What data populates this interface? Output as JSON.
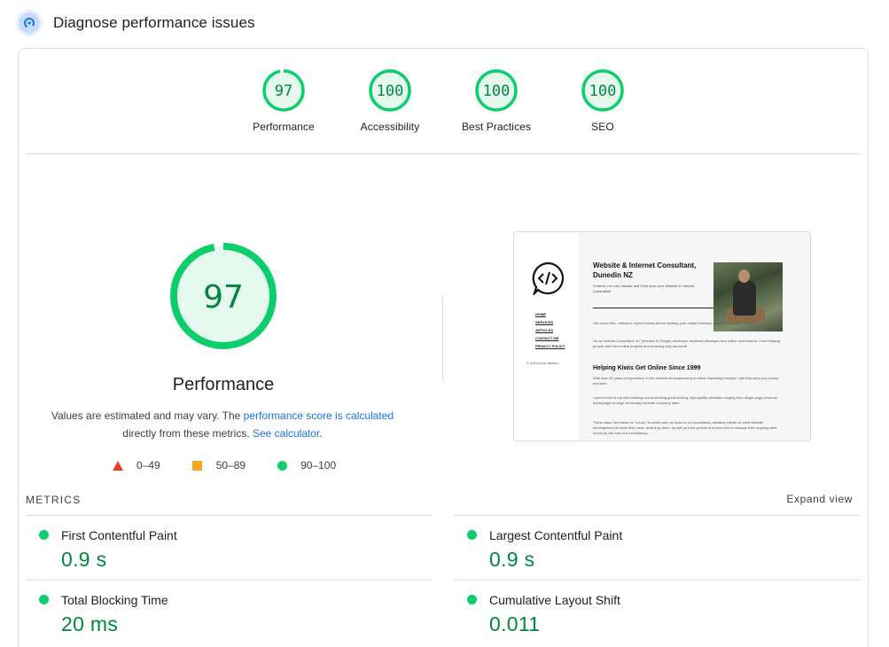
{
  "header": {
    "title": "Diagnose performance issues",
    "icon": "pagespeed-gauge-icon"
  },
  "categories": [
    {
      "score": "97",
      "label": "Performance",
      "fraction": 0.97
    },
    {
      "score": "100",
      "label": "Accessibility",
      "fraction": 1.0
    },
    {
      "score": "100",
      "label": "Best Practices",
      "fraction": 1.0
    },
    {
      "score": "100",
      "label": "SEO",
      "fraction": 1.0
    }
  ],
  "main_gauge": {
    "score": "97",
    "title": "Performance",
    "fraction": 0.97
  },
  "disclaimer": {
    "text1": "Values are estimated and may vary. The ",
    "link1": "performance score is calculated",
    "text2": " directly from these metrics. ",
    "link2": "See calculator",
    "text3": "."
  },
  "legend": {
    "fail": "0–49",
    "average": "50–89",
    "pass": "90–100"
  },
  "screenshot": {
    "heading": "Website & Internet Consultant, Dunedin NZ",
    "intro": "Hi there, I'm Lars Jansen and I'll be your next Website & Internet Consultant!",
    "nav": [
      "HOME",
      "SERVICES",
      "ARTICLES",
      "CONTACT ME",
      "PRIVACY POLICY"
    ],
    "copyright": "© 2024 Lars Jansen",
    "p1": "Get some free, unbiased, expert advice before starting your online business, project or website re-birth.",
    "p2": "I'm an Internet Consultant, IoT (Internet of Things) developer, backend developer and coffee connoisseur. I love helping people with their online projects and ensuring they succeed!",
    "subheading": "Helping Kiwis Get Online Since 1999",
    "p3": "With over 25 years of experience in the website development and online marketing industry I will help save you money and time.",
    "p4": "I spent most of my time building and promoting great looking, high quality websites ranging from single page personal homepages to large technically intricate company sites.",
    "p5": "These days I am based in \"sunny\" Dunedin and my focus is on consultancy, advising clients on what website development services they need, what they don't, as well as their options and how best to manage their ongoing sites, hourly by the cost of a consultancy..."
  },
  "metrics": {
    "title": "METRICS",
    "expand_label": "Expand view",
    "items": [
      {
        "name": "First Contentful Paint",
        "value": "0.9 s"
      },
      {
        "name": "Largest Contentful Paint",
        "value": "0.9 s"
      },
      {
        "name": "Total Blocking Time",
        "value": "20 ms"
      },
      {
        "name": "Cumulative Layout Shift",
        "value": "0.011"
      }
    ]
  },
  "colors": {
    "pass": "#0cce6b",
    "pass_text": "#018642",
    "average": "#f5a623",
    "fail": "#eb3b2e",
    "link": "#1a73e8"
  }
}
